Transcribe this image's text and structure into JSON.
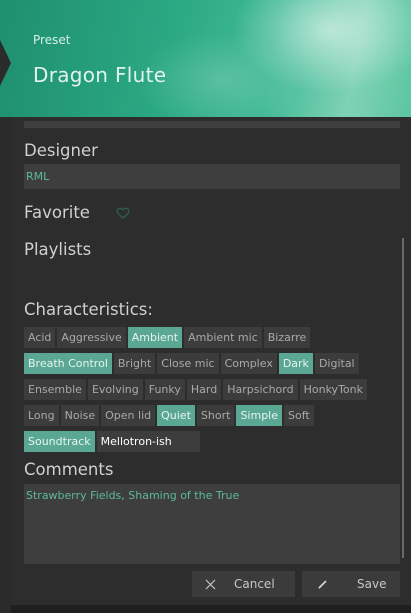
{
  "header": {
    "preset_label": "Preset",
    "preset_name": "Dragon Flute"
  },
  "designer": {
    "label": "Designer",
    "value": "RML"
  },
  "favorite": {
    "label": "Favorite",
    "icon": "heart-icon",
    "state": "not favorited"
  },
  "playlists": {
    "label": "Playlists"
  },
  "characteristics": {
    "label": "Characteristics:",
    "rows": [
      [
        {
          "label": "Acid",
          "selected": false
        },
        {
          "label": "Aggressive",
          "selected": false
        },
        {
          "label": "Ambient",
          "selected": true
        },
        {
          "label": "Ambient mic",
          "selected": false
        },
        {
          "label": "Bizarre",
          "selected": false
        }
      ],
      [
        {
          "label": "Breath Control",
          "selected": true
        },
        {
          "label": "Bright",
          "selected": false
        },
        {
          "label": "Close mic",
          "selected": false
        },
        {
          "label": "Complex",
          "selected": false
        },
        {
          "label": "Dark",
          "selected": true
        },
        {
          "label": "Digital",
          "selected": false
        }
      ],
      [
        {
          "label": "Ensemble",
          "selected": false
        },
        {
          "label": "Evolving",
          "selected": false
        },
        {
          "label": "Funky",
          "selected": false
        },
        {
          "label": "Hard",
          "selected": false
        },
        {
          "label": "Harpsichord",
          "selected": false
        },
        {
          "label": "HonkyTonk",
          "selected": false
        }
      ],
      [
        {
          "label": "Long",
          "selected": false
        },
        {
          "label": "Noise",
          "selected": false
        },
        {
          "label": "Open lid",
          "selected": false
        },
        {
          "label": "Quiet",
          "selected": true
        },
        {
          "label": "Short",
          "selected": false
        },
        {
          "label": "Simple",
          "selected": true
        },
        {
          "label": "Soft",
          "selected": false
        }
      ],
      [
        {
          "label": "Soundtrack",
          "selected": true
        },
        {
          "label": "Mellotron-ish",
          "selected": false,
          "custom": true
        }
      ]
    ]
  },
  "comments": {
    "label": "Comments",
    "value": "Strawberry Fields, Shaming of the True"
  },
  "buttons": {
    "cancel_label": "Cancel",
    "cancel_icon": "close-icon",
    "save_label": "Save",
    "save_icon": "pencil-icon"
  },
  "colors": {
    "accent": "#5aa893",
    "header": "#2aa882",
    "field_text": "#5db99a",
    "background": "#2b2b2b"
  }
}
